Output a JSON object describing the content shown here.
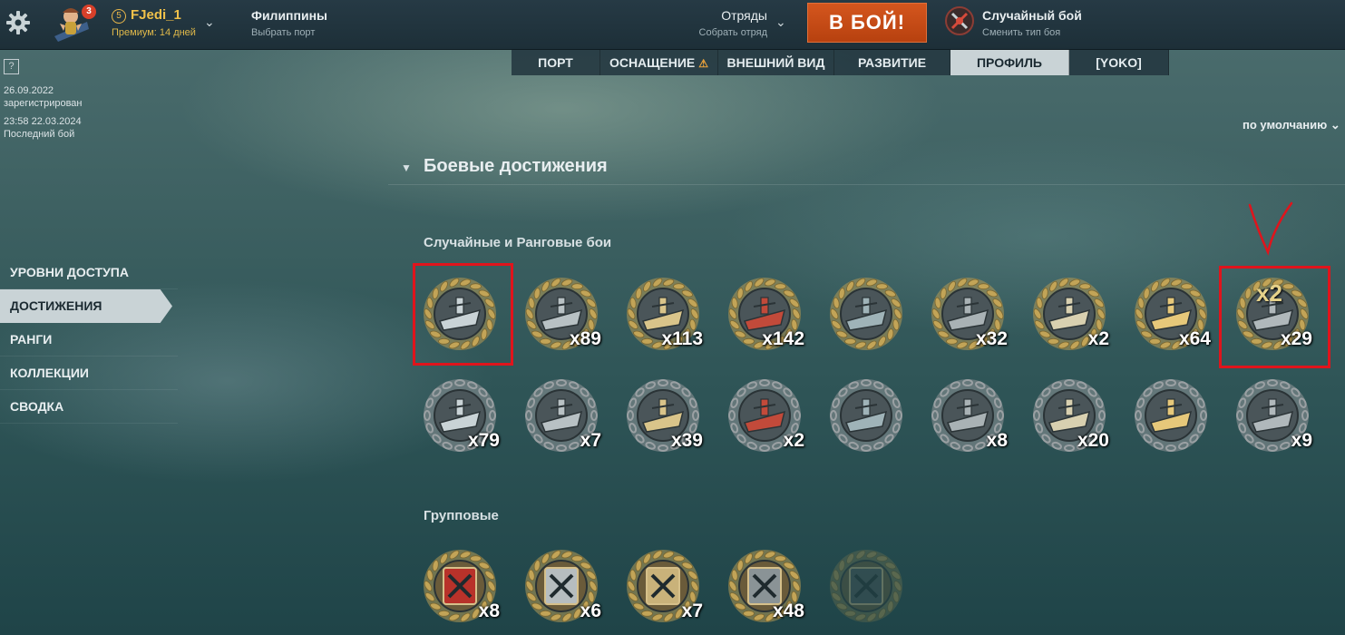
{
  "header": {
    "notification_count": "3",
    "level": "5",
    "username": "FJedi_1",
    "premium": "Премиум: 14 дней",
    "port": {
      "title": "Филиппины",
      "subtitle": "Выбрать порт"
    },
    "squads": {
      "title": "Отряды",
      "subtitle": "Собрать отряд"
    },
    "battle_button": "В БОЙ!",
    "mode": {
      "title": "Случайный бой",
      "subtitle": "Сменить тип боя"
    }
  },
  "tabs": [
    {
      "label": "ПОРТ",
      "active": false,
      "warning": false
    },
    {
      "label": "ОСНАЩЕНИЕ",
      "active": false,
      "warning": true
    },
    {
      "label": "ВНЕШНИЙ ВИД",
      "active": false,
      "warning": false
    },
    {
      "label": "РАЗВИТИЕ",
      "active": false,
      "warning": false
    },
    {
      "label": "ПРОФИЛЬ",
      "active": true,
      "warning": false
    },
    {
      "label": "[YOKO]",
      "active": false,
      "warning": false
    }
  ],
  "profile_info": {
    "help": "?",
    "registered_date": "26.09.2022",
    "registered_label": "зарегистрирован",
    "last_battle_time": "23:58  22.03.2024",
    "last_battle_label": "Последний бой"
  },
  "side_menu": [
    {
      "label": "УРОВНИ ДОСТУПА",
      "active": false
    },
    {
      "label": "ДОСТИЖЕНИЯ",
      "active": true
    },
    {
      "label": "РАНГИ",
      "active": false
    },
    {
      "label": "КОЛЛЕКЦИИ",
      "active": false
    },
    {
      "label": "СВОДКА",
      "active": false
    }
  ],
  "sort_label": "по умолчанию",
  "section_title": "Боевые достижения",
  "groups": {
    "random": {
      "title": "Случайные и Ранговые бои",
      "items": [
        {
          "icon": "ship-ribbon-laurel-icon",
          "count": ""
        },
        {
          "icon": "kraken-octopus-icon",
          "count": "x89"
        },
        {
          "icon": "torpedo-laurel-icon",
          "count": "x113"
        },
        {
          "icon": "trident-red-laurel-icon",
          "count": "x142"
        },
        {
          "icon": "wave-ship-laurel-icon",
          "count": ""
        },
        {
          "icon": "battleship-laurel-icon",
          "count": "x32"
        },
        {
          "icon": "binoculars-laurel-icon",
          "count": "x2"
        },
        {
          "icon": "carrier-explosion-icon",
          "count": "x64"
        },
        {
          "icon": "double-strike-icon",
          "count": "x29",
          "overlay": "x2"
        },
        {
          "icon": "hourglass-chain-icon",
          "count": "x79"
        },
        {
          "icon": "aa-gun-chain-icon",
          "count": "x7"
        },
        {
          "icon": "turret-fire-chain-icon",
          "count": "x39"
        },
        {
          "icon": "burning-ship-chain-icon",
          "count": "x2"
        },
        {
          "icon": "wave-ship-chain-icon",
          "count": ""
        },
        {
          "icon": "flame-anchor-chain-icon",
          "count": "x8"
        },
        {
          "icon": "gold-anchor-chain-icon",
          "count": "x20"
        },
        {
          "icon": "sail-bow-chain-icon",
          "count": ""
        },
        {
          "icon": "explosion-chain-icon",
          "count": "x9"
        }
      ]
    },
    "team": {
      "title": "Групповые",
      "items": [
        {
          "icon": "red-shield-arrow-icon",
          "count": "x8"
        },
        {
          "icon": "fortress-sword-icon",
          "count": "x6"
        },
        {
          "icon": "fist-lightning-icon",
          "count": "x7"
        },
        {
          "icon": "trident-shield-icon",
          "count": "x48"
        },
        {
          "icon": "locked-kraken-icon",
          "count": ""
        }
      ]
    }
  },
  "colors": {
    "battle_button": "#c8481a",
    "gold": "#f1c14a",
    "highlight": "#e0141c",
    "active_tab": "#c9d3d6"
  }
}
